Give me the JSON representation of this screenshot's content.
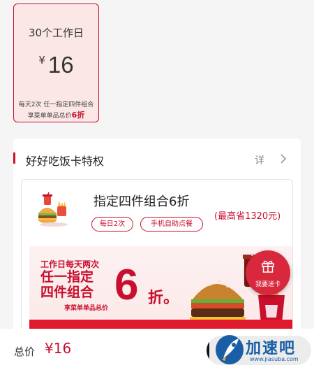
{
  "plan": {
    "days": "30个工作日",
    "currency": "¥",
    "price": "16",
    "desc1": "每天2次 任一指定四件组合",
    "desc2_prefix": "享菜单单品总价",
    "desc2_discount": "6折"
  },
  "privilege": {
    "title": "好好吃饭卡特权",
    "more": "详",
    "offer": {
      "title": "指定四件组合6折",
      "save": "(最高省1320元)",
      "tags": [
        "每日2次",
        "手机自助点餐"
      ]
    },
    "banner": {
      "line1": "工作日每天两次",
      "line2": "任一指定",
      "line3": "四件组合",
      "line4": "享菜单单品总价",
      "six": "6",
      "zhe": "折。"
    }
  },
  "fab": {
    "label": "我要送卡"
  },
  "bottom": {
    "total_label": "总价",
    "total_value": "¥16"
  },
  "watermark": {
    "title": "加速吧",
    "url": "www.jiasuba.com"
  },
  "colors": {
    "brand_red": "#c8102e",
    "plan_bg": "#fce7e7",
    "fab_red": "#d8283d"
  }
}
